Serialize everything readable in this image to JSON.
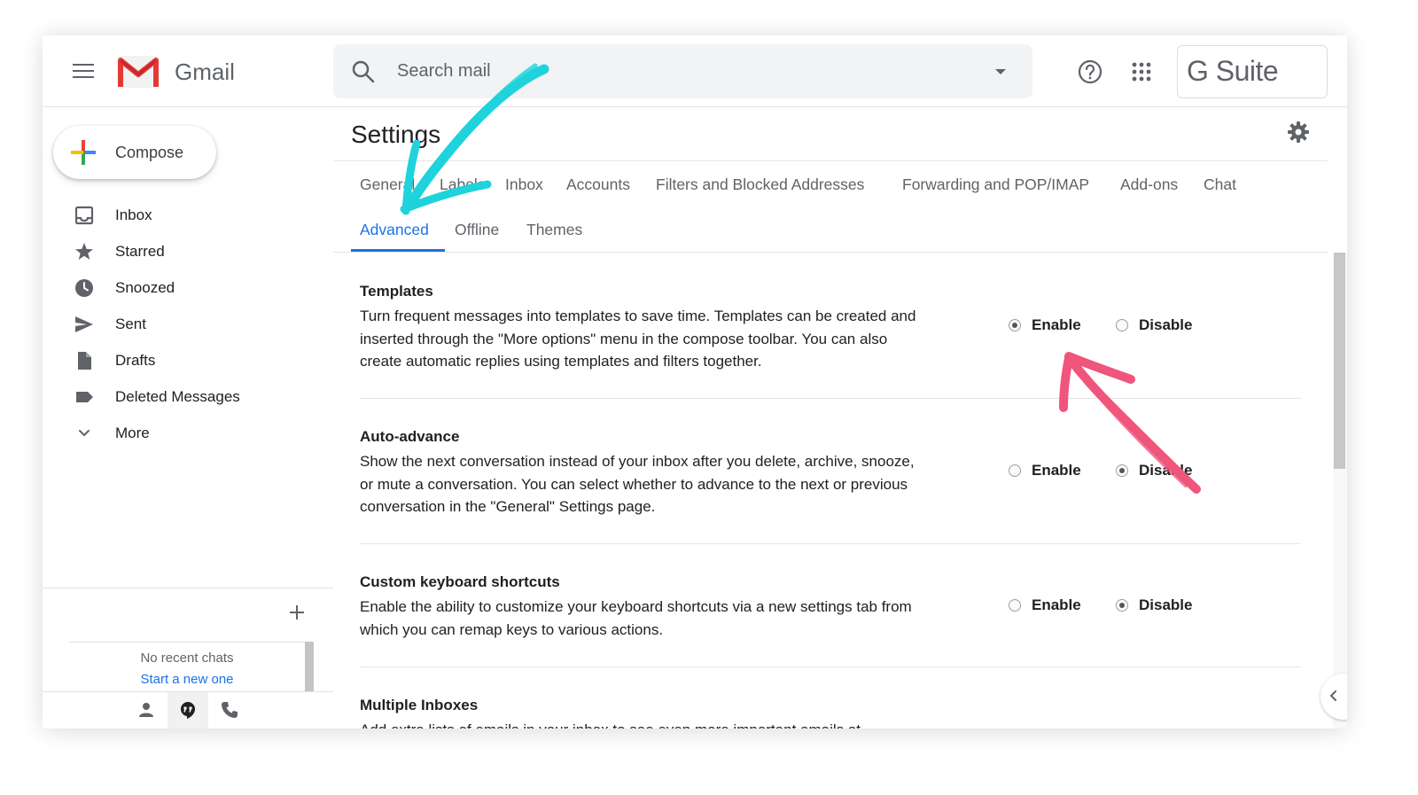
{
  "header": {
    "app_name": "Gmail",
    "search_placeholder": "Search mail",
    "brand": "G Suite"
  },
  "sidebar": {
    "compose_label": "Compose",
    "items": [
      {
        "label": "Inbox",
        "icon": "inbox-icon"
      },
      {
        "label": "Starred",
        "icon": "star-icon"
      },
      {
        "label": "Snoozed",
        "icon": "clock-icon"
      },
      {
        "label": "Sent",
        "icon": "send-icon"
      },
      {
        "label": "Drafts",
        "icon": "draft-icon"
      },
      {
        "label": "Deleted Messages",
        "icon": "label-icon"
      },
      {
        "label": "More",
        "icon": "chevron-down-icon"
      }
    ],
    "chat": {
      "empty_text": "No recent chats",
      "start_link": "Start a new one"
    }
  },
  "settings": {
    "title": "Settings",
    "tabs": [
      "General",
      "Labels",
      "Inbox",
      "Accounts",
      "Filters and Blocked Addresses",
      "Forwarding and POP/IMAP",
      "Add-ons",
      "Chat",
      "Advanced",
      "Offline",
      "Themes"
    ],
    "active_tab": "Advanced",
    "enable_label": "Enable",
    "disable_label": "Disable",
    "sections": [
      {
        "title": "Templates",
        "description": "Turn frequent messages into templates to save time. Templates can be created and inserted through the \"More options\" menu in the compose toolbar. You can also create automatic replies using templates and filters together.",
        "selected": "Enable"
      },
      {
        "title": "Auto-advance",
        "description": "Show the next conversation instead of your inbox after you delete, archive, snooze, or mute a conversation. You can select whether to advance to the next or previous conversation in the \"General\" Settings page.",
        "selected": "Disable"
      },
      {
        "title": "Custom keyboard shortcuts",
        "description": "Enable the ability to customize your keyboard shortcuts via a new settings tab from which you can remap keys to various actions.",
        "selected": "Disable"
      },
      {
        "title": "Multiple Inboxes",
        "description": "Add extra lists of emails in your inbox to see even more important emails at"
      }
    ]
  },
  "colors": {
    "accent": "#1a73e8",
    "annotation_cyan": "#1ed3dc",
    "annotation_pink": "#f0557c"
  }
}
